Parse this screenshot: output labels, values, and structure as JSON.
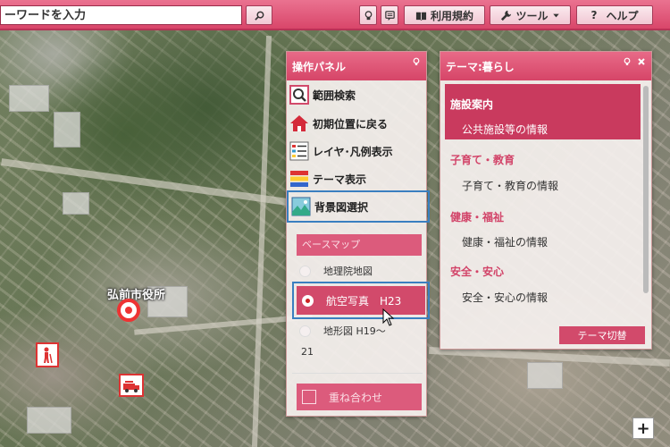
{
  "toolbar": {
    "search_value": "ーワードを入力",
    "terms_label": "利用規約",
    "tools_label": "ツール",
    "help_label": "ヘルプ",
    "accent_color": "#d9466a"
  },
  "map": {
    "label": "弘前市役所",
    "zoom_in_label": "+"
  },
  "operation_panel": {
    "title": "操作パネル",
    "items": [
      {
        "label": "範囲検索",
        "icon": "magnifier-icon"
      },
      {
        "label": "初期位置に戻る",
        "icon": "home-icon"
      },
      {
        "label": "レイヤ･凡例表示",
        "icon": "legend-icon"
      },
      {
        "label": "テーマ表示",
        "icon": "theme-icon"
      },
      {
        "label": "背景図選択",
        "icon": "landscape-icon"
      }
    ],
    "basemap_header": "ベースマップ",
    "basemaps": [
      {
        "label": "地理院地図",
        "selected": false
      },
      {
        "label": "航空写真　H23",
        "selected": true
      },
      {
        "label": "地形図 H19～",
        "selected": false
      }
    ],
    "basemap_wrap": "21",
    "overlay_label": "重ね合わせ"
  },
  "theme_panel": {
    "title": "テーマ:暮らし",
    "categories": [
      {
        "name": "施設案内",
        "item": "公共施設等の情報"
      },
      {
        "name": "子育て・教育",
        "item": "子育て・教育の情報"
      },
      {
        "name": "健康・福祉",
        "item": "健康・福祉の情報"
      },
      {
        "name": "安全・安心",
        "item": "安全・安心の情報"
      }
    ],
    "switch_label": "テーマ切替"
  }
}
